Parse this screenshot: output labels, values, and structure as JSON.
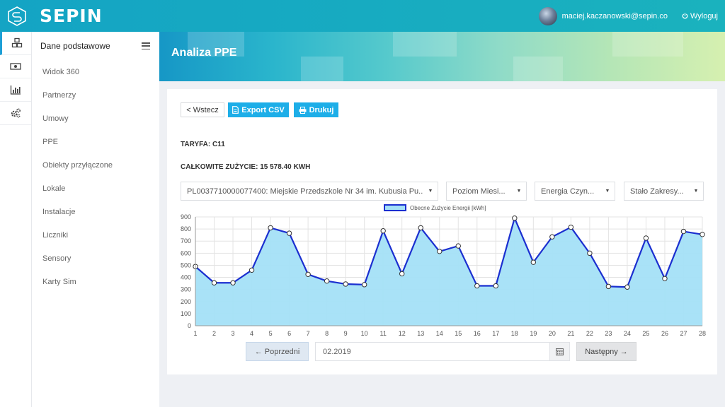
{
  "brand": {
    "name": "SEPIN"
  },
  "user": {
    "email": "maciej.kaczanowski@sepin.co",
    "logout_label": "Wyloguj"
  },
  "icon_rail": [
    "cubes-icon",
    "money-icon",
    "bar-chart-icon",
    "gears-icon"
  ],
  "sidebar": {
    "title": "Dane podstawowe",
    "items": [
      {
        "label": "Widok 360"
      },
      {
        "label": "Partnerzy"
      },
      {
        "label": "Umowy"
      },
      {
        "label": "PPE"
      },
      {
        "label": "Obiekty przyłączone"
      },
      {
        "label": "Lokale"
      },
      {
        "label": "Instalacje"
      },
      {
        "label": "Liczniki"
      },
      {
        "label": "Sensory"
      },
      {
        "label": "Karty Sim"
      }
    ]
  },
  "page": {
    "title": "Analiza PPE"
  },
  "toolbar": {
    "back_label": "< Wstecz",
    "csv_label": "Export CSV",
    "print_label": "Drukuj"
  },
  "info": {
    "tariff": "TARYFA: C11",
    "total": "CAŁKOWITE ZUŻYCIE: 15 578.40 KWH"
  },
  "filters": {
    "ppe": "PL0037710000077400: Miejskie Przedszkole Nr 34 im. Kubusia Pu...",
    "level": "Poziom Miesi...",
    "energy": "Energia Czyn...",
    "range": "Stało Zakresy..."
  },
  "pager": {
    "prev_label": "← Poprzedni",
    "date": "02.2019",
    "next_label": "Następny →"
  },
  "colors": {
    "accent": "#1daee8",
    "line": "#1b2fd0",
    "fill": "#a4e0f7",
    "topbar": "#14a4c4"
  },
  "chart_data": {
    "type": "area",
    "x": [
      1,
      2,
      3,
      4,
      5,
      6,
      7,
      8,
      9,
      10,
      11,
      12,
      13,
      14,
      15,
      16,
      17,
      18,
      19,
      20,
      21,
      22,
      23,
      24,
      25,
      26,
      27,
      28
    ],
    "series": [
      {
        "name": "Obecne Zużycie Energii [kWh]",
        "values": [
          490,
          355,
          355,
          460,
          810,
          765,
          425,
          370,
          345,
          340,
          785,
          430,
          810,
          615,
          660,
          330,
          330,
          890,
          525,
          735,
          815,
          600,
          325,
          320,
          725,
          390,
          780,
          755
        ]
      }
    ],
    "ylim": [
      0,
      900
    ],
    "yticks": [
      0,
      100,
      200,
      300,
      400,
      500,
      600,
      700,
      800,
      900
    ],
    "grid": true,
    "legend": "top-center"
  }
}
